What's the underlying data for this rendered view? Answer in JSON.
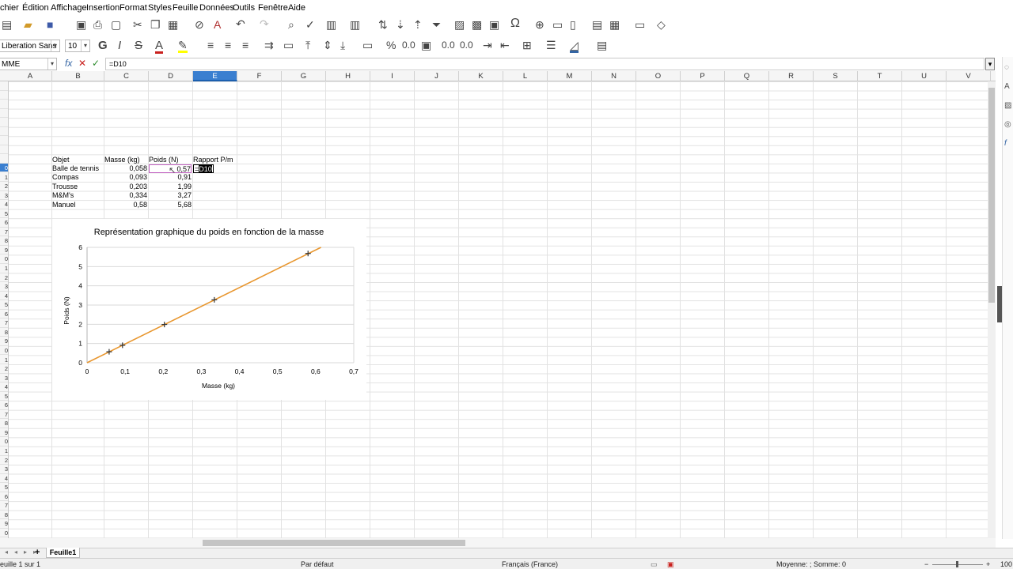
{
  "menu": [
    "chier",
    "Édition",
    "Affichage",
    "Insertion",
    "Format",
    "Styles",
    "Feuille",
    "Données",
    "Outils",
    "Fenêtre",
    "Aide"
  ],
  "toolbar": {
    "font_name": "Liberation Sans",
    "font_size": "10",
    "bold": "G",
    "italic": "I",
    "strike": "S",
    "percent": "%",
    "decimals": "0.0",
    "add_dec": "0.0",
    "del_dec": "0.0",
    "special_char": "Ω"
  },
  "formula_bar": {
    "name_box": "MME",
    "fx": "fx",
    "cancel": "✕",
    "accept": "✓",
    "content": "=D10"
  },
  "columns": [
    "A",
    "B",
    "C",
    "D",
    "E",
    "F",
    "G",
    "H",
    "I",
    "J",
    "K",
    "L",
    "M",
    "N",
    "O",
    "P",
    "Q",
    "R",
    "S",
    "T",
    "U",
    "V"
  ],
  "active_column": "E",
  "rows": [
    "",
    "",
    "",
    "",
    "",
    "",
    "",
    "",
    "",
    "0",
    "1",
    "2",
    "3",
    "4",
    "5",
    "6",
    "7",
    "8",
    "9",
    "0",
    "1",
    "2",
    "3",
    "4",
    "5",
    "6",
    "7",
    "8",
    "9",
    "0",
    "1",
    "2",
    "3",
    "4",
    "5",
    "6",
    "7",
    "8",
    "9",
    "0",
    "1",
    "2",
    "3",
    "4",
    "5",
    "6",
    "7",
    "8",
    "9",
    "0"
  ],
  "sheet": {
    "header": [
      "Objet",
      "Masse (kg)",
      "Poids (N)",
      "Rapport P/m"
    ],
    "data": [
      {
        "objet": "Balle de tennis",
        "masse": "0,058",
        "poids": "0,57"
      },
      {
        "objet": "Compas",
        "masse": "0,093",
        "poids": "0,91"
      },
      {
        "objet": "Trousse",
        "masse": "0,203",
        "poids": "1,99"
      },
      {
        "objet": "M&M's",
        "masse": "0,334",
        "poids": "3,27"
      },
      {
        "objet": "Manuel",
        "masse": "0,58",
        "poids": "5,68"
      }
    ],
    "editing_prefix": "=",
    "editing_ref": "D10"
  },
  "chart_data": {
    "type": "scatter",
    "title": "Représentation graphique du poids en fonction de la masse",
    "xlabel": "Masse (kg)",
    "ylabel": "Poids (N)",
    "x": [
      0.058,
      0.093,
      0.203,
      0.334,
      0.58
    ],
    "y": [
      0.57,
      0.91,
      1.99,
      3.27,
      5.68
    ],
    "trendline": {
      "x": [
        0,
        0.614
      ],
      "y": [
        0,
        6.0
      ]
    },
    "xlim": [
      0,
      0.7
    ],
    "ylim": [
      0,
      6
    ],
    "xticks": [
      "0",
      "0,1",
      "0,2",
      "0,3",
      "0,4",
      "0,5",
      "0,6",
      "0,7"
    ],
    "yticks": [
      "0",
      "1",
      "2",
      "3",
      "4",
      "5",
      "6"
    ],
    "grid": true,
    "line_color": "#e8962e",
    "marker_color": "#333333"
  },
  "tabs": {
    "add": "+",
    "sheet1": "Feuille1"
  },
  "status": {
    "sheet": "euille 1 sur 1",
    "style": "Par défaut",
    "lang": "Français (France)",
    "stats": "Moyenne: ; Somme: 0",
    "zoom": "100"
  }
}
